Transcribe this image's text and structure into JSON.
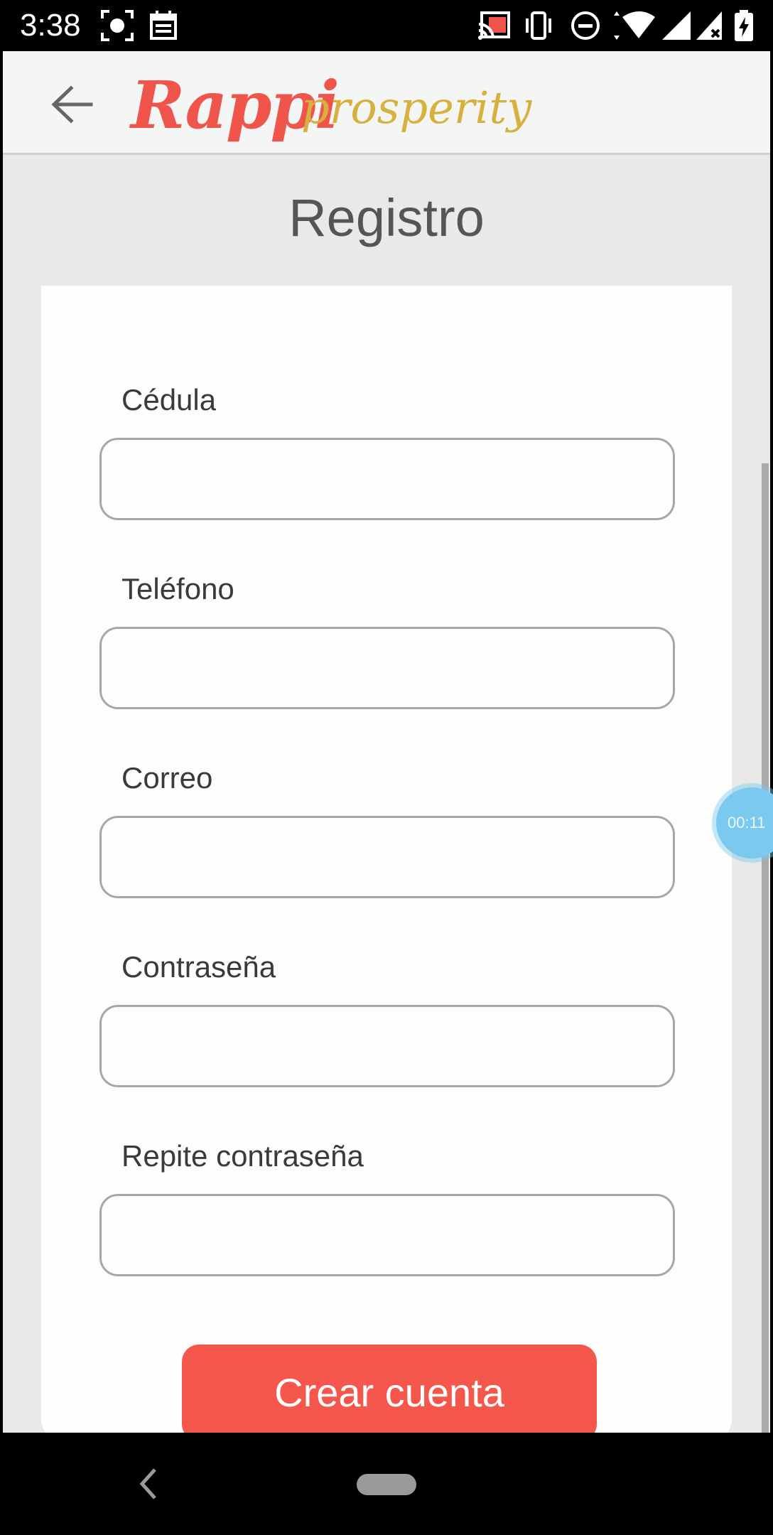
{
  "status_bar": {
    "time": "3:38",
    "icons": [
      "screenshot-icon",
      "calendar-icon",
      "cast-icon",
      "vibrate-icon",
      "do-not-disturb-icon",
      "wifi-icon",
      "signal-icon",
      "battery-charging-icon"
    ]
  },
  "toolbar": {
    "back_icon": "arrow-left-icon",
    "logo_primary": "Rappi",
    "logo_secondary": "prosperity"
  },
  "page": {
    "title": "Registro"
  },
  "form": {
    "fields": [
      {
        "label": "Cédula",
        "value": "",
        "placeholder": ""
      },
      {
        "label": "Teléfono",
        "value": "",
        "placeholder": ""
      },
      {
        "label": "Correo",
        "value": "",
        "placeholder": ""
      },
      {
        "label": "Contraseña",
        "value": "",
        "placeholder": ""
      },
      {
        "label": "Repite contraseña",
        "value": "",
        "placeholder": ""
      }
    ],
    "submit_label": "Crear cuenta"
  },
  "overlay": {
    "timer": "00:11"
  },
  "nav_bar": {
    "back_icon": "nav-back-icon",
    "home_icon": "home-pill-icon"
  },
  "colors": {
    "brand_red": "#f5574c",
    "brand_gold": "#d6b13d",
    "background": "#e9eae8",
    "card": "#fdfdfb"
  }
}
